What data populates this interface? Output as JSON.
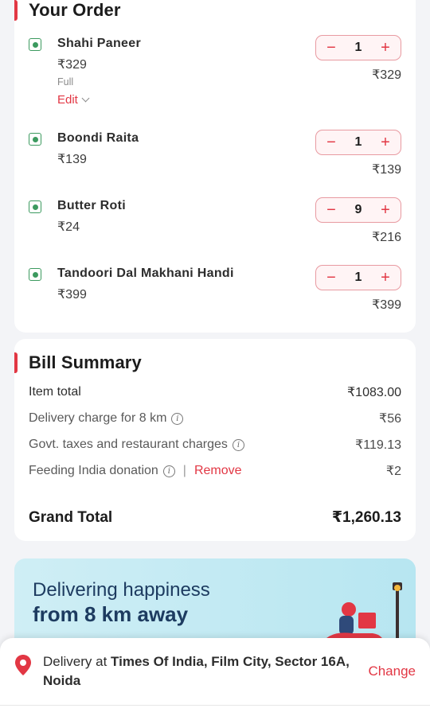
{
  "order": {
    "title": "Your Order",
    "items": [
      {
        "name": "Shahi Paneer",
        "price": "₹329",
        "variant": "Full",
        "edit": "Edit",
        "qty": "1",
        "total": "₹329"
      },
      {
        "name": "Boondi Raita",
        "price": "₹139",
        "qty": "1",
        "total": "₹139"
      },
      {
        "name": "Butter Roti",
        "price": "₹24",
        "qty": "9",
        "total": "₹216"
      },
      {
        "name": "Tandoori Dal Makhani Handi",
        "price": "₹399",
        "qty": "1",
        "total": "₹399"
      }
    ],
    "minus": "−",
    "plus": "+"
  },
  "bill": {
    "title": "Bill Summary",
    "item_total_label": "Item total",
    "item_total": "₹1083.00",
    "delivery_label": "Delivery charge for 8 km",
    "delivery": "₹56",
    "taxes_label": "Govt. taxes and restaurant charges",
    "taxes": "₹119.13",
    "donation_label": "Feeding India donation",
    "separator": "|",
    "remove": "Remove",
    "donation": "₹2",
    "grand_label": "Grand Total",
    "grand": "₹1,260.13"
  },
  "promo": {
    "line1": "Delivering happiness",
    "line2": "from 8 km away"
  },
  "delivery": {
    "prefix": "Delivery at ",
    "address": "Times Of India, Film City, Sector 16A, Noida",
    "change": "Change"
  },
  "colors": {
    "accent": "#e23744",
    "veg": "#3c9a5f",
    "promo_bg": "#b7e6f1",
    "promo_text": "#1d3b60"
  },
  "icons": {
    "veg": "veg-icon",
    "info": "info-icon",
    "chevron": "chevron-down-icon",
    "location": "location-pin-icon",
    "rider": "delivery-rider-illustration"
  }
}
